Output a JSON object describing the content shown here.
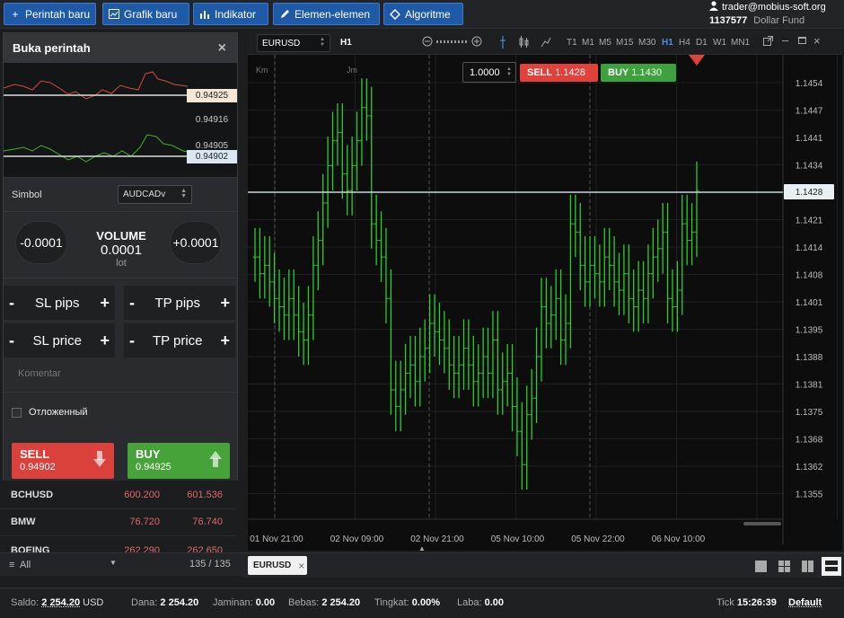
{
  "toolbar": {
    "new_order": "Perintah baru",
    "new_chart": "Grafik baru",
    "indicator": "Indikator",
    "elements": "Elemen-elemen",
    "algorithm": "Algoritme"
  },
  "account": {
    "user": "trader@mobius-soft.org",
    "fund_id": "1137577",
    "fund_label": "Dollar Fund"
  },
  "order_panel": {
    "title": "Buka perintah",
    "mini_prices": [
      "0.94925",
      "0.94916",
      "0.94905",
      "0.94902"
    ],
    "symbol_label": "Simbol",
    "symbol_value": "AUDCADv",
    "vol_minus": "-0.0001",
    "vol_plus": "+0.0001",
    "volume_label": "VOLUME",
    "volume_value": "0.0001",
    "volume_unit": "lot",
    "sl_pips": "SL pips",
    "tp_pips": "TP pips",
    "sl_price": "SL price",
    "tp_price": "TP price",
    "minus": "-",
    "plus": "+",
    "comment_placeholder": "Komentar",
    "pending_label": "Отложенный",
    "sell_label": "SELL",
    "sell_price": "0.94902",
    "buy_label": "BUY",
    "buy_price": "0.94925"
  },
  "symbol_list": [
    {
      "name": "BCHUSD",
      "bid": "600.200",
      "ask": "601.536"
    },
    {
      "name": "BMW",
      "bid": "76.720",
      "ask": "76.740"
    },
    {
      "name": "BOEING",
      "bid": "262.290",
      "ask": "262.650"
    }
  ],
  "list_footer": {
    "filter": "All",
    "count": "135 / 135"
  },
  "chart": {
    "symbol": "EURUSD",
    "timeframe": "H1",
    "timeframes": [
      "T1",
      "M1",
      "M5",
      "M15",
      "M30",
      "H1",
      "H4",
      "D1",
      "W1",
      "MN1"
    ],
    "active_timeframe": "H1",
    "session_labels": [
      "Km",
      "Jm"
    ],
    "quantity": "1.0000",
    "sell_label": "SELL",
    "sell_price": "1.1428",
    "buy_label": "BUY",
    "buy_price": "1.1430",
    "current_price": "1.1428",
    "colors": {
      "bull": "#2ecc2e",
      "bear": "#2ecc2e",
      "sell": "#e0413a",
      "buy": "#3da13d"
    }
  },
  "chart_data": {
    "type": "line",
    "title": "",
    "y_ticks": [
      "1.1454",
      "1.1447",
      "1.1441",
      "1.1434",
      "1.1428",
      "1.1421",
      "1.1414",
      "1.1408",
      "1.1401",
      "1.1395",
      "1.1388",
      "1.1381",
      "1.1375",
      "1.1368",
      "1.1362",
      "1.1355"
    ],
    "x_ticks": [
      "01 Nov 21:00",
      "02 Nov 09:00",
      "02 Nov 21:00",
      "05 Nov 10:00",
      "05 Nov 22:00",
      "06 Nov 10:00"
    ],
    "ylim": [
      1.135,
      1.1458
    ],
    "grid": true,
    "series": [
      {
        "values": [
          1.1412,
          1.1408,
          1.141,
          1.1406,
          1.1402,
          1.14,
          1.1398,
          1.1402,
          1.1398,
          1.1394,
          1.1392,
          1.1398,
          1.141,
          1.1416,
          1.1425,
          1.1434,
          1.144,
          1.1442,
          1.1432,
          1.1428,
          1.1434,
          1.144,
          1.1448,
          1.1446,
          1.142,
          1.1416,
          1.1412,
          1.1402,
          1.138,
          1.1376,
          1.138,
          1.1384,
          1.1386,
          1.1382,
          1.1388,
          1.139,
          1.1396,
          1.1394,
          1.1392,
          1.139,
          1.1386,
          1.1384,
          1.1386,
          1.139,
          1.1386,
          1.1382,
          1.1384,
          1.1388,
          1.1384,
          1.1392,
          1.138,
          1.1382,
          1.1384,
          1.1376,
          1.137,
          1.1362,
          1.1374,
          1.1378,
          1.1388,
          1.14,
          1.1396,
          1.1398,
          1.1402,
          1.1392,
          1.1396,
          1.142,
          1.1418,
          1.141,
          1.1406,
          1.141,
          1.1408,
          1.1406,
          1.1412,
          1.141,
          1.1406,
          1.1404,
          1.1408,
          1.1402,
          1.14,
          1.1404,
          1.1402,
          1.1408,
          1.1412,
          1.1414,
          1.1418,
          1.1402,
          1.14,
          1.1404,
          1.142,
          1.1416,
          1.1418,
          1.1428
        ]
      }
    ]
  },
  "tabs": {
    "chart_tab": "EURUSD"
  },
  "status": {
    "balance_label": "Saldo:",
    "balance": "2 254.20",
    "currency": "USD",
    "funds_label": "Dana:",
    "funds": "2 254.20",
    "margin_label": "Jaminan:",
    "margin": "0.00",
    "free_label": "Bebas:",
    "free": "2 254.20",
    "level_label": "Tingkat:",
    "level": "0.00%",
    "profit_label": "Laba:",
    "profit": "0.00",
    "tick_label": "Tick",
    "time": "15:26:39",
    "profile": "Default"
  }
}
